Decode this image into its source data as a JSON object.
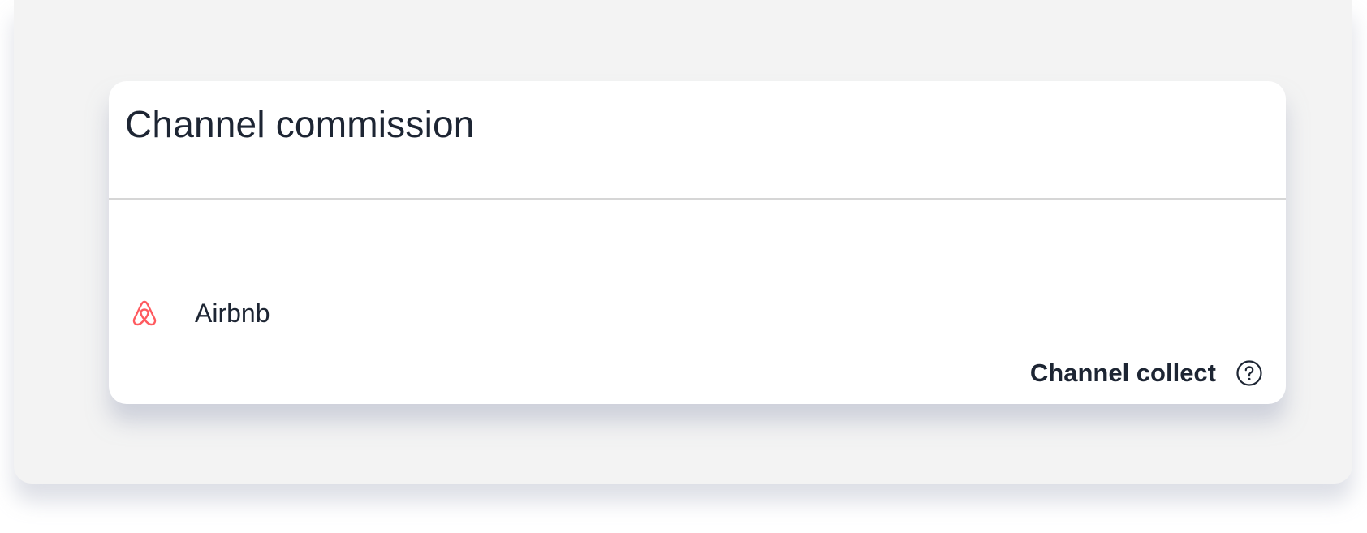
{
  "card": {
    "title": "Channel commission"
  },
  "channel": {
    "name": "Airbnb",
    "icon": "airbnb-logo-icon",
    "brand_color": "#ff5a5f"
  },
  "collect": {
    "label": "Channel collect",
    "help_icon": "question-circle-icon"
  }
}
